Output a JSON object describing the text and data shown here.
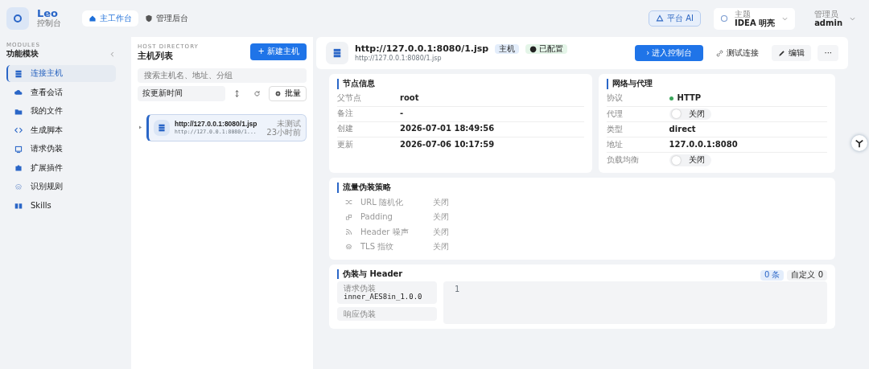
{
  "brand": {
    "name": "Leo",
    "subtitle": "控制台"
  },
  "top_tabs": [
    {
      "label": "主工作台",
      "selected": true
    },
    {
      "label": "管理后台",
      "selected": false
    }
  ],
  "top_right": {
    "ai_button": "平台 AI",
    "theme": {
      "label": "主题",
      "value": "IDEA 明亮"
    },
    "user": {
      "label": "管理员",
      "value": "admin"
    }
  },
  "sidebar": {
    "eyebrow": "MODULES",
    "title": "功能模块",
    "items": [
      {
        "label": "连接主机",
        "selected": true
      },
      {
        "label": "查看会话",
        "selected": false
      },
      {
        "label": "我的文件",
        "selected": false
      },
      {
        "label": "生成脚本",
        "selected": false
      },
      {
        "label": "请求伪装",
        "selected": false
      },
      {
        "label": "扩展插件",
        "selected": false
      },
      {
        "label": "识别规则",
        "selected": false
      },
      {
        "label": "Skills",
        "selected": false
      }
    ]
  },
  "host_list": {
    "eyebrow": "HOST DIRECTORY",
    "title": "主机列表",
    "new_button": "+ 新建主机",
    "search": {
      "placeholder": "搜索主机名、地址、分组"
    },
    "sort": "按更新时间",
    "batch_button": "批量",
    "hosts": [
      {
        "name": "http://127.0.0.1:8080/1.jsp",
        "url": "http://127.0.0.1:8080/1...",
        "status": "未测试",
        "time": "23小时前",
        "selected": true
      }
    ]
  },
  "detail": {
    "title": "http://127.0.0.1:8080/1.jsp",
    "subtitle": "http://127.0.0.1:8080/1.jsp",
    "tags": [
      {
        "label": "主机",
        "color": "#e3edfb"
      },
      {
        "label": "● 已配置",
        "color": "#e4f5e8"
      }
    ],
    "actions": [
      {
        "label": "› 进入控制台",
        "kind": "primary"
      },
      {
        "label": "测试连接",
        "kind": "link"
      },
      {
        "label": "编辑",
        "kind": "edit"
      },
      {
        "label": "···",
        "kind": "more"
      }
    ],
    "node_info": {
      "title": "节点信息",
      "rows": [
        {
          "label": "父节点",
          "value": "root"
        },
        {
          "label": "备注",
          "value": "-"
        },
        {
          "label": "创建",
          "value": "2026-07-01 18:49:56"
        },
        {
          "label": "更新",
          "value": "2026-07-06 10:17:59"
        }
      ]
    },
    "network": {
      "title": "网络与代理",
      "rows": [
        {
          "label": "协议",
          "kind": "dot",
          "value": "HTTP"
        },
        {
          "label": "代理",
          "kind": "switch",
          "value": "关闭",
          "on": false
        },
        {
          "label": "类型",
          "kind": "text",
          "value": "direct"
        },
        {
          "label": "地址",
          "kind": "text",
          "value": "127.0.0.1:8080"
        },
        {
          "label": "负载均衡",
          "kind": "switch",
          "value": "关闭",
          "on": false
        }
      ]
    },
    "traffic": {
      "title": "流量伪装策略",
      "rows": [
        {
          "label": "URL 随机化",
          "value": "关闭"
        },
        {
          "label": "Padding",
          "value": "关闭"
        },
        {
          "label": "Header 噪声",
          "value": "关闭"
        },
        {
          "label": "TLS 指纹",
          "value": "关闭"
        }
      ]
    },
    "headers": {
      "title": "伪装与 Header",
      "count": "0 条",
      "custom": "自定义 0",
      "items": [
        {
          "label": "请求伪装",
          "value": "inner_AES8in_1.0.0"
        },
        {
          "label": "响应伪装",
          "value": ""
        }
      ],
      "editor_line": "1"
    }
  }
}
